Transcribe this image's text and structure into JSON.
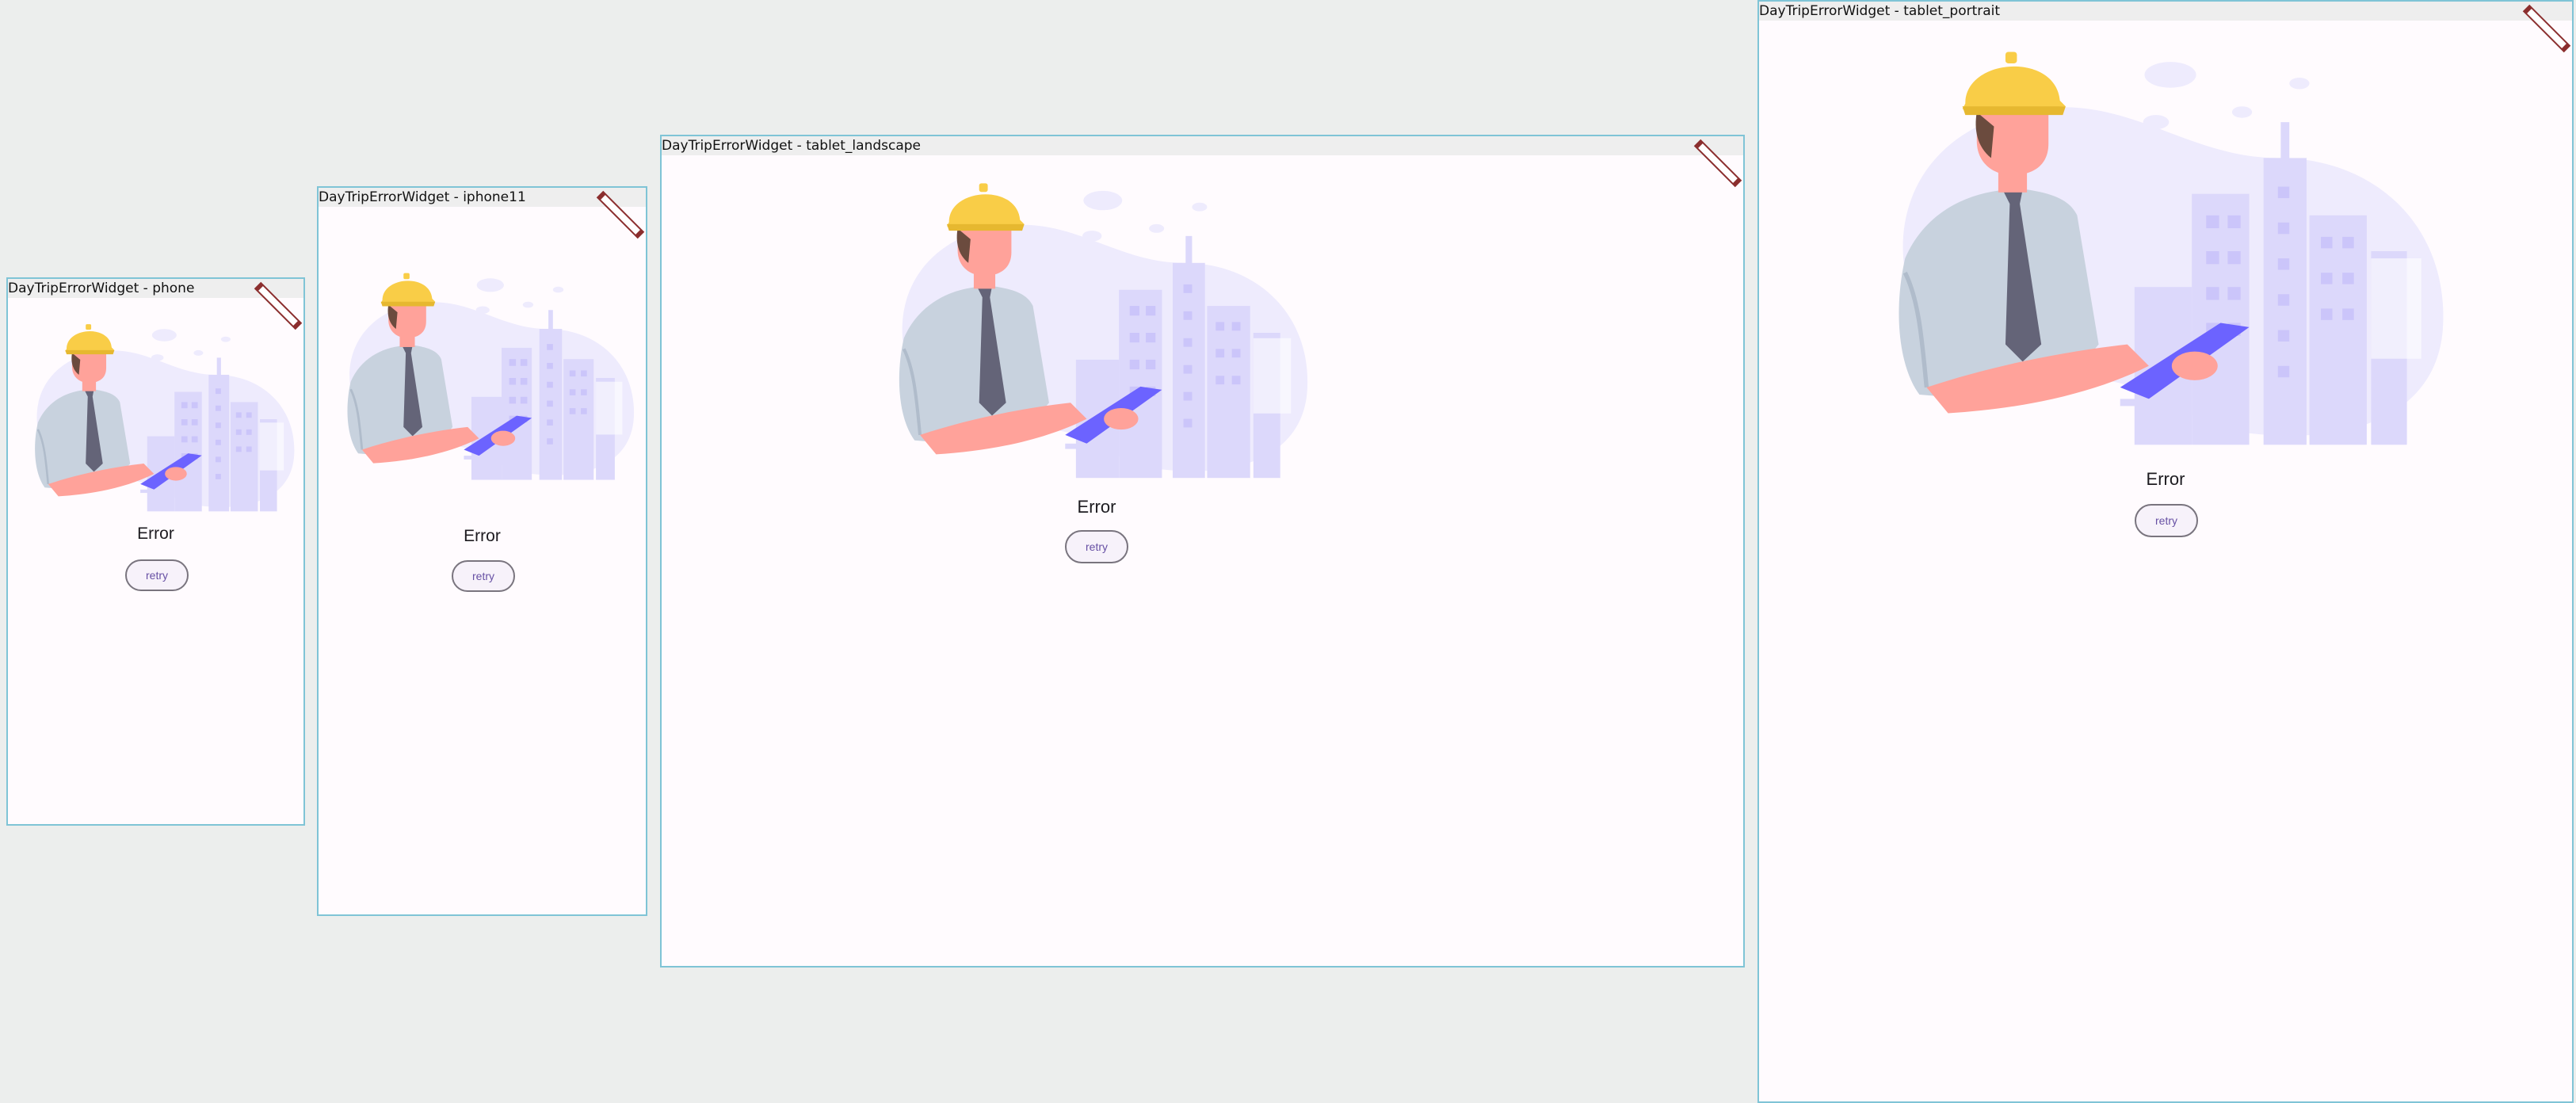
{
  "canvas": {
    "background": "#eceeed"
  },
  "colors": {
    "frame_border": "#7fc4d6",
    "screen_background": "#fffbfe",
    "button_text": "#6750a4",
    "helmet": "#f9cd47",
    "tablet": "#6c63ff",
    "skin": "#ffa29a",
    "tie": "#646478",
    "debug_banner": "#8b2e2e"
  },
  "devices": [
    {
      "label": "DayTripErrorWidget - phone",
      "error_text": "Error",
      "retry_label": "retry",
      "debug_banner_icon": "debug-banner-icon"
    },
    {
      "label": "DayTripErrorWidget - iphone11",
      "error_text": "Error",
      "retry_label": "retry",
      "debug_banner_icon": "debug-banner-icon"
    },
    {
      "label": "DayTripErrorWidget - tablet_landscape",
      "error_text": "Error",
      "retry_label": "retry",
      "debug_banner_icon": "debug-banner-icon"
    },
    {
      "label": "DayTripErrorWidget - tablet_portrait",
      "error_text": "Error",
      "retry_label": "retry",
      "debug_banner_icon": "debug-banner-icon"
    }
  ],
  "illustration": {
    "name": "engineer-with-tablet-illustration"
  }
}
